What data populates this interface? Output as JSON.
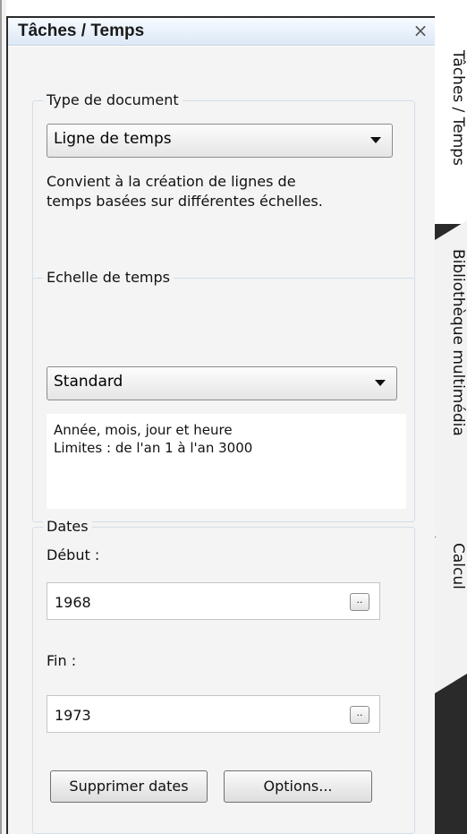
{
  "panel": {
    "title": "Tâches / Temps",
    "close_glyph": "×"
  },
  "document_type": {
    "legend": "Type de document",
    "selected": "Ligne de temps",
    "description_line1": "Convient à la création de lignes de",
    "description_line2": "temps basées sur différentes échelles."
  },
  "time_scale": {
    "legend": "Echelle de temps",
    "selected": "Standard",
    "info_line1": "Année, mois, jour et heure",
    "info_line2": "Limites : de l'an 1 à l'an 3000"
  },
  "dates": {
    "legend": "Dates",
    "start_label": "Début :",
    "start_value": "1968",
    "end_label": "Fin :",
    "end_value": "1973",
    "ellipsis_label": "..",
    "delete_button": "Supprimer dates",
    "options_button": "Options..."
  },
  "side_tabs": [
    {
      "label": "Tâches / Temps",
      "active": true
    },
    {
      "label": "Bibliothèque multimédia",
      "active": false
    },
    {
      "label": "Calcul",
      "active": false
    }
  ],
  "icons": {
    "close": "close-icon",
    "dropdown": "chevron-down-icon"
  },
  "colors": {
    "header_top": "#f7fbff",
    "header_bottom": "#dce8f6",
    "panel_bg": "#f4f4f4",
    "tab_strip": "#2a2a2a"
  }
}
